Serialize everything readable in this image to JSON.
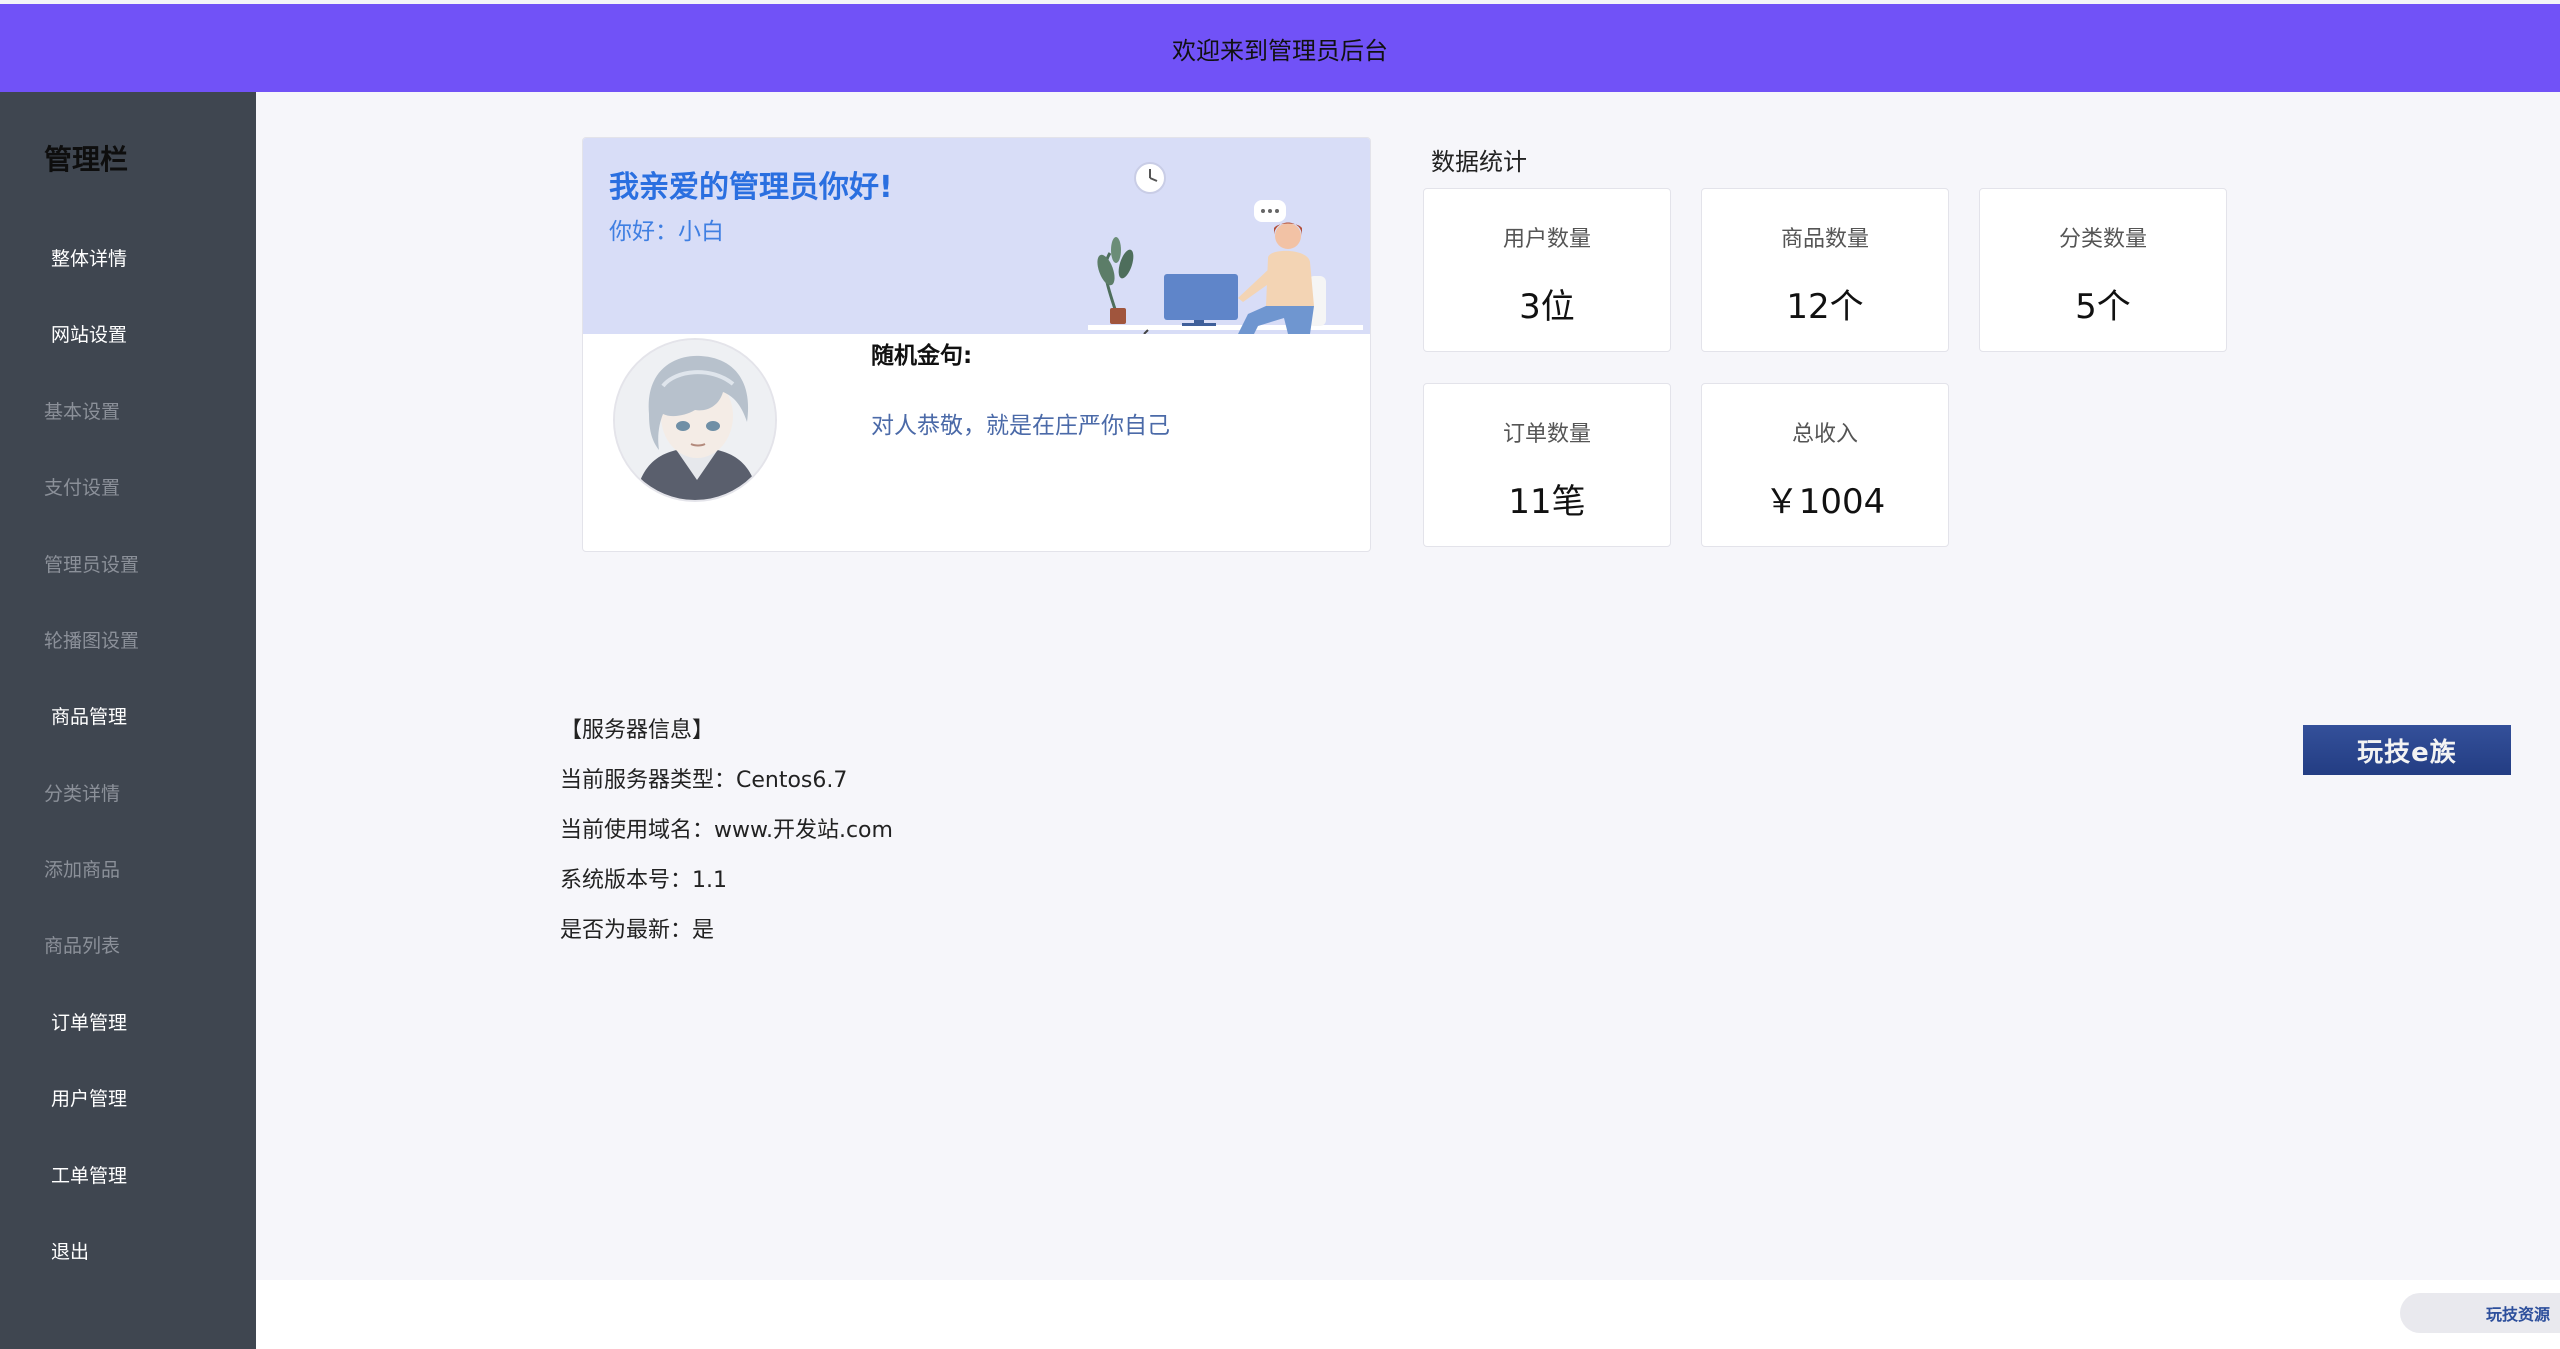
{
  "header": {
    "title": "欢迎来到管理员后台",
    "bg_color": "#7152f7"
  },
  "sidebar": {
    "title": "管理栏",
    "items": [
      {
        "label": "整体详情",
        "level": "main"
      },
      {
        "label": "网站设置",
        "level": "main"
      },
      {
        "label": "基本设置",
        "level": "sub"
      },
      {
        "label": "支付设置",
        "level": "sub"
      },
      {
        "label": "管理员设置",
        "level": "sub"
      },
      {
        "label": "轮播图设置",
        "level": "sub"
      },
      {
        "label": "商品管理",
        "level": "main"
      },
      {
        "label": "分类详情",
        "level": "sub"
      },
      {
        "label": "添加商品",
        "level": "sub"
      },
      {
        "label": "商品列表",
        "level": "sub"
      },
      {
        "label": "订单管理",
        "level": "main"
      },
      {
        "label": "用户管理",
        "level": "main"
      },
      {
        "label": "工单管理",
        "level": "main"
      },
      {
        "label": "退出",
        "level": "main"
      }
    ]
  },
  "welcome": {
    "title": "我亲爱的管理员你好!",
    "greeting": "你好：小白",
    "quote_label": "随机金句:",
    "quote": "对人恭敬，就是在庄严你自己"
  },
  "stats": {
    "title": "数据统计",
    "cards": [
      {
        "label": "用户数量",
        "value": "3位"
      },
      {
        "label": "商品数量",
        "value": "12个"
      },
      {
        "label": "分类数量",
        "value": "5个"
      },
      {
        "label": "订单数量",
        "value": "11笔"
      },
      {
        "label": "总收入",
        "value": "￥1004"
      }
    ]
  },
  "server": {
    "heading": "【服务器信息】",
    "lines": [
      "当前服务器类型：Centos6.7",
      "当前使用域名：www.开发站.com",
      "系统版本号：1.1",
      "是否为最新：是"
    ]
  },
  "brand": {
    "badge": "玩技e族",
    "bottom": "玩技资源"
  }
}
